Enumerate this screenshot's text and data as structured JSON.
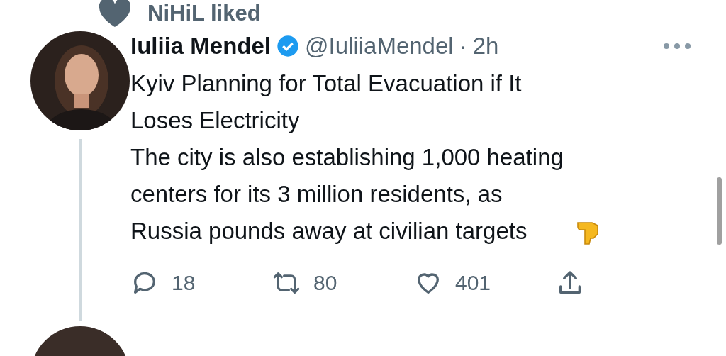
{
  "social_context": {
    "text": "NiHiL liked"
  },
  "tweet": {
    "author_name": "Iuliia Mendel",
    "verified": true,
    "handle": "@IuliiaMendel",
    "separator": "·",
    "time": "2h",
    "title_lines": [
      "Kyiv Planning for Total Evacuation if It",
      "Loses Electricity"
    ],
    "body_lines": [
      "The city is also establishing 1,000 heating",
      "centers for its 3 million residents, as",
      "Russia pounds away at civilian targets"
    ],
    "actions": [
      {
        "kind": "reply",
        "count": "18"
      },
      {
        "kind": "retweet",
        "count": "80"
      },
      {
        "kind": "like",
        "count": "401"
      },
      {
        "kind": "share"
      }
    ]
  }
}
